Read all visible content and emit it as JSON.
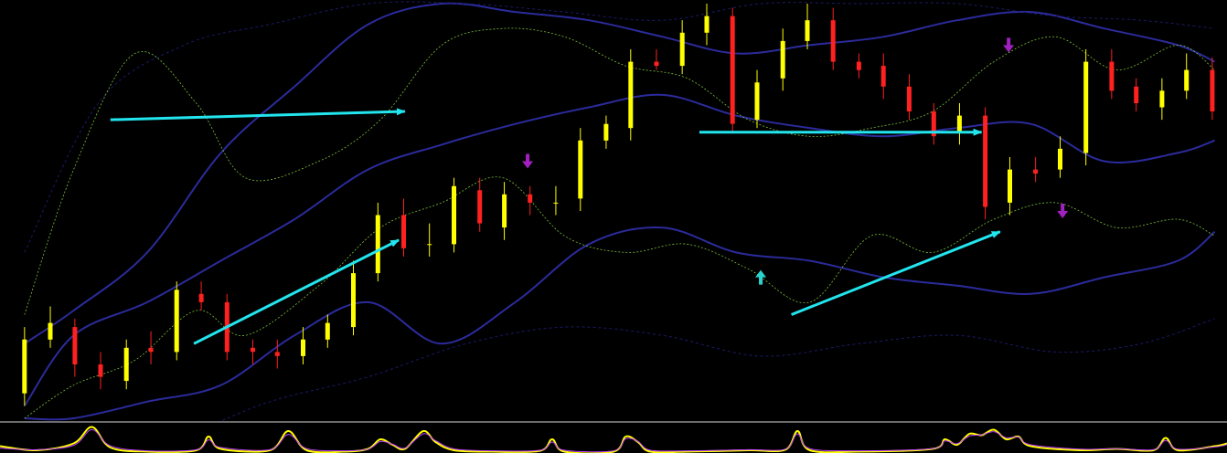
{
  "chart_data": [
    {
      "type": "line",
      "panel": "main",
      "title": "",
      "xlabel": "",
      "ylabel": "",
      "grid": false,
      "legend": "none",
      "ylim": [
        0,
        100
      ],
      "colors": {
        "background": "#000000",
        "frame": "#d8d8d8",
        "bull_candle": "#ffff00",
        "bear_candle": "#ff2020",
        "envelope_band": "#2b2b9c",
        "inner_band": "#7cbf3a",
        "outer_band": "#1a1a6a",
        "trend_arrow": "#22e5ee",
        "signal_up": "#2ad4cc",
        "signal_down": "#a020c0"
      },
      "candles": {
        "x": [
          2.0,
          4.1,
          6.1,
          8.2,
          10.3,
          12.3,
          14.4,
          16.4,
          18.5,
          20.6,
          22.6,
          24.7,
          26.7,
          28.8,
          30.8,
          32.9,
          35.0,
          37.0,
          39.1,
          41.1,
          43.2,
          45.3,
          47.3,
          49.4,
          51.4,
          53.5,
          55.6,
          57.6,
          59.7,
          61.7,
          63.8,
          65.8,
          67.9,
          70.0,
          72.0,
          74.1,
          76.1,
          78.2,
          80.3,
          82.3,
          84.4,
          86.4,
          88.5,
          90.6,
          92.6,
          94.7,
          96.7,
          98.8
        ],
        "open": [
          6.0,
          19.0,
          22.0,
          13.0,
          9.0,
          17.0,
          16.0,
          30.0,
          28.0,
          17.0,
          16.0,
          15.0,
          19.0,
          22.0,
          35.0,
          49.0,
          42.0,
          42.0,
          55.0,
          46.0,
          54.0,
          52.0,
          53.0,
          67.0,
          70.0,
          86.0,
          85.0,
          93.0,
          97.0,
          72.0,
          82.0,
          91.0,
          96.0,
          86.0,
          85.0,
          80.0,
          74.0,
          69.0,
          73.0,
          52.0,
          60.0,
          60.0,
          64.0,
          86.0,
          80.0,
          75.0,
          79.0,
          84.0
        ],
        "close": [
          19.0,
          23.0,
          13.0,
          10.0,
          17.0,
          16.0,
          31.0,
          28.0,
          16.0,
          16.0,
          15.0,
          19.0,
          23.0,
          35.0,
          49.0,
          41.0,
          42.0,
          56.0,
          47.0,
          54.0,
          52.0,
          52.0,
          67.0,
          71.0,
          86.0,
          85.0,
          93.0,
          97.0,
          71.0,
          81.0,
          91.0,
          96.0,
          86.0,
          84.0,
          80.0,
          74.0,
          68.0,
          73.0,
          51.0,
          60.0,
          59.0,
          65.0,
          86.0,
          79.0,
          76.0,
          79.0,
          84.0,
          74.0
        ],
        "high": [
          22.0,
          27.0,
          24.0,
          16.0,
          19.0,
          21.0,
          33.0,
          33.0,
          30.0,
          19.0,
          19.0,
          22.0,
          25.0,
          38.0,
          52.0,
          53.0,
          47.0,
          58.0,
          58.0,
          57.0,
          56.0,
          56.0,
          70.0,
          73.0,
          89.0,
          89.0,
          96.0,
          100.0,
          99.0,
          84.0,
          94.0,
          100.0,
          99.0,
          88.0,
          88.0,
          83.0,
          76.0,
          76.0,
          75.0,
          63.0,
          63.0,
          68.0,
          89.0,
          89.0,
          82.0,
          82.0,
          88.0,
          87.0
        ],
        "low": [
          3.0,
          17.0,
          10.0,
          7.0,
          7.0,
          13.0,
          14.0,
          26.0,
          14.0,
          13.0,
          12.0,
          13.0,
          17.0,
          20.0,
          33.0,
          39.0,
          39.0,
          40.0,
          45.0,
          43.0,
          49.0,
          49.0,
          50.0,
          65.0,
          67.0,
          84.0,
          83.0,
          90.0,
          69.0,
          70.0,
          79.0,
          89.0,
          84.0,
          82.0,
          77.0,
          72.0,
          66.0,
          66.0,
          48.0,
          49.0,
          57.0,
          58.0,
          61.0,
          77.0,
          74.0,
          72.0,
          77.0,
          72.0
        ]
      },
      "series": [
        {
          "role": "envelope-upper",
          "style": "solid",
          "x": [
            2.0,
            6.0,
            12.0,
            18.0,
            24.0,
            30.0,
            36.0,
            42.0,
            48.0,
            54.0,
            60.0,
            66.0,
            72.0,
            78.0,
            84.0,
            90.0,
            96.0,
            99.0
          ],
          "values": [
            18.0,
            26.0,
            40.0,
            64.0,
            80.0,
            95.0,
            100.0,
            98.0,
            96.0,
            92.0,
            88.0,
            90.0,
            92.0,
            96.0,
            98.0,
            94.0,
            90.0,
            86.0
          ]
        },
        {
          "role": "envelope-middle",
          "style": "solid",
          "x": [
            2.0,
            6.0,
            12.0,
            18.0,
            24.0,
            30.0,
            36.0,
            42.0,
            48.0,
            54.0,
            60.0,
            66.0,
            72.0,
            78.0,
            84.0,
            90.0,
            96.0,
            99.0
          ],
          "values": [
            3.0,
            20.0,
            28.0,
            38.0,
            48.0,
            60.0,
            66.0,
            71.0,
            75.0,
            78.0,
            73.0,
            70.0,
            68.0,
            70.0,
            71.0,
            62.0,
            64.0,
            67.0
          ]
        },
        {
          "role": "envelope-lower",
          "style": "solid",
          "x": [
            2.0,
            6.0,
            12.0,
            18.0,
            24.0,
            30.0,
            36.0,
            42.0,
            48.0,
            54.0,
            60.0,
            66.0,
            72.0,
            78.0,
            84.0,
            90.0,
            96.0,
            99.0
          ],
          "values": [
            0.0,
            0.0,
            4.0,
            8.0,
            20.0,
            28.0,
            18.0,
            28.0,
            42.0,
            46.0,
            40.0,
            38.0,
            34.0,
            32.0,
            30.0,
            34.0,
            38.0,
            45.0
          ]
        },
        {
          "role": "band-outer-upper",
          "style": "solid",
          "x": [
            2.0,
            8.0,
            15.0,
            22.0,
            30.0,
            38.0,
            46.0,
            54.0,
            62.0,
            70.0,
            78.0,
            86.0,
            93.0,
            99.0
          ],
          "values": [
            40.0,
            76.0,
            90.0,
            95.0,
            100.0,
            100.0,
            98.0,
            96.0,
            100.0,
            100.0,
            100.0,
            97.0,
            96.0,
            94.0
          ]
        },
        {
          "role": "band-outer-lower",
          "style": "solid",
          "x": [
            2.0,
            8.0,
            15.0,
            22.0,
            30.0,
            38.0,
            46.0,
            54.0,
            62.0,
            70.0,
            78.0,
            86.0,
            93.0,
            99.0
          ],
          "values": [
            -10.0,
            -8.0,
            -4.0,
            4.0,
            10.0,
            18.0,
            22.0,
            20.0,
            15.0,
            18.0,
            20.0,
            16.0,
            18.0,
            24.0
          ]
        },
        {
          "role": "band-inner-upper",
          "style": "dashed",
          "x": [
            2.0,
            6.0,
            11.0,
            16.0,
            20.0,
            26.0,
            31.0,
            36.0,
            41.0,
            46.0,
            51.0,
            56.0,
            61.0,
            66.0,
            71.0,
            76.0,
            81.0,
            86.0,
            91.0,
            96.0,
            99.0
          ],
          "values": [
            25.0,
            60.0,
            88.0,
            76.0,
            58.0,
            62.0,
            72.0,
            90.0,
            94.0,
            92.0,
            85.0,
            82.0,
            72.0,
            68.0,
            70.0,
            74.0,
            86.0,
            92.0,
            84.0,
            90.0,
            84.0
          ]
        },
        {
          "role": "band-inner-lower",
          "style": "dashed",
          "x": [
            2.0,
            6.0,
            11.0,
            16.0,
            20.0,
            26.0,
            31.0,
            36.0,
            41.0,
            46.0,
            51.0,
            56.0,
            61.0,
            66.0,
            71.0,
            76.0,
            81.0,
            86.0,
            91.0,
            96.0,
            99.0
          ],
          "values": [
            0.0,
            8.0,
            14.0,
            26.0,
            20.0,
            32.0,
            46.0,
            52.0,
            58.0,
            44.0,
            40.0,
            42.0,
            36.0,
            28.0,
            44.0,
            40.0,
            48.0,
            52.0,
            46.0,
            48.0,
            44.0
          ]
        }
      ],
      "trend_arrows": [
        {
          "x0": 9.0,
          "y0": 72.0,
          "x1": 33.0,
          "y1": 74.0
        },
        {
          "x0": 15.8,
          "y0": 18.0,
          "x1": 32.5,
          "y1": 43.0
        },
        {
          "x0": 57.0,
          "y0": 69.0,
          "x1": 80.0,
          "y1": 69.0
        },
        {
          "x0": 64.5,
          "y0": 25.0,
          "x1": 81.5,
          "y1": 45.0
        }
      ],
      "signals": [
        {
          "kind": "up",
          "x": 62.0,
          "y": 34.0
        },
        {
          "kind": "down",
          "x": 43.0,
          "y": 62.0
        },
        {
          "kind": "down",
          "x": 82.2,
          "y": 90.0
        },
        {
          "kind": "down",
          "x": 86.6,
          "y": 50.0
        }
      ]
    },
    {
      "type": "line",
      "panel": "oscillator",
      "title": "",
      "xlabel": "",
      "ylabel": "",
      "grid": false,
      "legend": "none",
      "ylim": [
        0,
        100
      ],
      "colors": {
        "line_primary": "#ffff00",
        "line_secondary": "#c040ff"
      },
      "series": [
        {
          "role": "oscillator-main",
          "x": [
            0.0,
            3.0,
            6.0,
            7.5,
            9.0,
            12.0,
            16.0,
            17.0,
            18.0,
            22.0,
            23.5,
            25.0,
            28.0,
            30.0,
            31.0,
            32.0,
            33.0,
            34.5,
            35.5,
            37.0,
            40.0,
            44.0,
            45.0,
            46.0,
            50.0,
            51.0,
            52.0,
            53.0,
            56.0,
            61.0,
            64.0,
            65.0,
            66.0,
            70.0,
            76.0,
            77.0,
            78.0,
            79.0,
            80.0,
            81.0,
            82.0,
            83.0,
            84.0,
            88.0,
            91.0,
            94.0,
            95.0,
            96.0,
            99.0,
            100.0
          ],
          "values": [
            25.0,
            10.0,
            35.0,
            95.0,
            20.0,
            5.0,
            10.0,
            60.0,
            15.0,
            10.0,
            80.0,
            10.0,
            5.0,
            15.0,
            50.0,
            30.0,
            15.0,
            80.0,
            40.0,
            10.0,
            5.0,
            8.0,
            50.0,
            5.0,
            5.0,
            60.0,
            40.0,
            5.0,
            5.0,
            10.0,
            12.0,
            80.0,
            10.0,
            5.0,
            15.0,
            50.0,
            30.0,
            70.0,
            65.0,
            85.0,
            50.0,
            60.0,
            25.0,
            10.0,
            15.0,
            10.0,
            55.0,
            10.0,
            25.0,
            35.0
          ]
        },
        {
          "role": "oscillator-signal",
          "x": [
            0.0,
            3.0,
            6.0,
            7.5,
            9.0,
            12.0,
            16.0,
            17.0,
            18.0,
            22.0,
            23.5,
            25.0,
            28.0,
            30.0,
            31.0,
            32.0,
            33.0,
            34.5,
            35.5,
            37.0,
            40.0,
            44.0,
            45.0,
            46.0,
            50.0,
            51.0,
            52.0,
            53.0,
            56.0,
            61.0,
            64.0,
            65.0,
            66.0,
            70.0,
            76.0,
            77.0,
            78.0,
            79.0,
            80.0,
            81.0,
            82.0,
            83.0,
            84.0,
            88.0,
            91.0,
            94.0,
            95.0,
            96.0,
            99.0,
            100.0
          ],
          "values": [
            18.0,
            12.0,
            28.0,
            85.0,
            26.0,
            8.0,
            12.0,
            48.0,
            20.0,
            12.0,
            68.0,
            16.0,
            8.0,
            14.0,
            42.0,
            32.0,
            18.0,
            70.0,
            45.0,
            15.0,
            8.0,
            10.0,
            40.0,
            10.0,
            8.0,
            52.0,
            42.0,
            10.0,
            8.0,
            12.0,
            14.0,
            70.0,
            16.0,
            8.0,
            16.0,
            44.0,
            34.0,
            62.0,
            66.0,
            78.0,
            56.0,
            58.0,
            30.0,
            14.0,
            16.0,
            12.0,
            46.0,
            14.0,
            22.0,
            30.0
          ]
        }
      ]
    }
  ]
}
